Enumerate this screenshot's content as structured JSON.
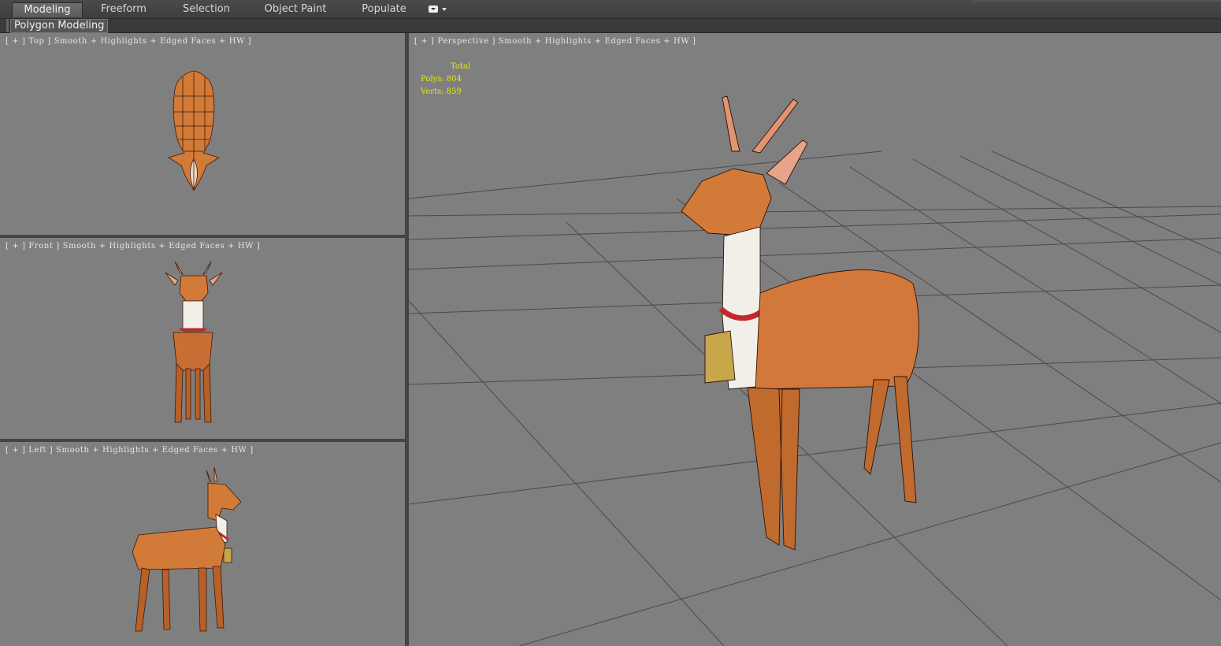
{
  "ribbon": {
    "tabs": [
      {
        "label": "Modeling",
        "active": true
      },
      {
        "label": "Freeform",
        "active": false
      },
      {
        "label": "Selection",
        "active": false
      },
      {
        "label": "Object Paint",
        "active": false
      },
      {
        "label": "Populate",
        "active": false
      }
    ],
    "dropdown_icon": "panel-options-icon"
  },
  "sub_panel": {
    "label": "Polygon Modeling"
  },
  "viewports": {
    "top": {
      "label": "[ + ] Top ] Smooth + Highlights + Edged Faces + HW ]"
    },
    "front": {
      "label": "[ + ] Front ] Smooth + Highlights + Edged Faces + HW ]"
    },
    "left": {
      "label": "[ + ] Left ] Smooth + Highlights + Edged Faces + HW ]"
    },
    "perspective": {
      "label": "[ + ] Perspective ] Smooth + Highlights + Edged Faces + HW ]"
    }
  },
  "stats": {
    "total_label": "Total",
    "polys_label": "Polys:",
    "polys_value": "804",
    "verts_label": "Verts:",
    "verts_value": "859"
  },
  "colors": {
    "viewport_bg": "#7f7f7f",
    "stats_text": "#e8e80e",
    "deer_fur": "#d27a38",
    "collar": "#c22a2a",
    "bell": "#c8a64a"
  }
}
